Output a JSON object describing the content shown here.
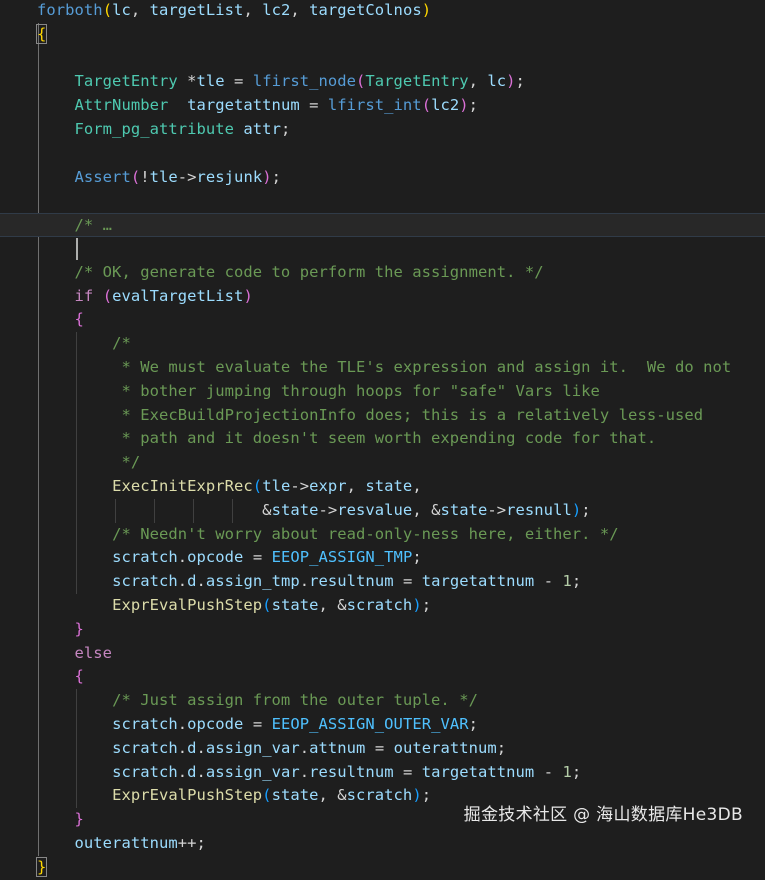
{
  "editor": {
    "language": "c",
    "cursor_line": 10,
    "highlighted_line": 9
  },
  "watermark": "掘金技术社区 @ 海山数据库He3DB",
  "lines": [
    [
      {
        "t": "forboth",
        "c": "k"
      },
      {
        "t": "(",
        "c": "b1"
      },
      {
        "t": "lc",
        "c": "v"
      },
      {
        "t": ", ",
        "c": "o"
      },
      {
        "t": "targetList",
        "c": "v"
      },
      {
        "t": ", ",
        "c": "o"
      },
      {
        "t": "lc2",
        "c": "v"
      },
      {
        "t": ", ",
        "c": "o"
      },
      {
        "t": "targetColnos",
        "c": "v"
      },
      {
        "t": ")",
        "c": "b1"
      }
    ],
    [
      {
        "t": "{",
        "c": "b1"
      }
    ],
    [],
    [
      {
        "t": "    ",
        "c": "o"
      },
      {
        "t": "TargetEntry",
        "c": "t"
      },
      {
        "t": " *",
        "c": "o"
      },
      {
        "t": "tle",
        "c": "v"
      },
      {
        "t": " = ",
        "c": "o"
      },
      {
        "t": "lfirst_node",
        "c": "k"
      },
      {
        "t": "(",
        "c": "b2"
      },
      {
        "t": "TargetEntry",
        "c": "t"
      },
      {
        "t": ", ",
        "c": "o"
      },
      {
        "t": "lc",
        "c": "v"
      },
      {
        "t": ")",
        "c": "b2"
      },
      {
        "t": ";",
        "c": "o"
      }
    ],
    [
      {
        "t": "    ",
        "c": "o"
      },
      {
        "t": "AttrNumber",
        "c": "t"
      },
      {
        "t": "  ",
        "c": "o"
      },
      {
        "t": "targetattnum",
        "c": "v"
      },
      {
        "t": " = ",
        "c": "o"
      },
      {
        "t": "lfirst_int",
        "c": "k"
      },
      {
        "t": "(",
        "c": "b2"
      },
      {
        "t": "lc2",
        "c": "v"
      },
      {
        "t": ")",
        "c": "b2"
      },
      {
        "t": ";",
        "c": "o"
      }
    ],
    [
      {
        "t": "    ",
        "c": "o"
      },
      {
        "t": "Form_pg_attribute",
        "c": "t"
      },
      {
        "t": " ",
        "c": "o"
      },
      {
        "t": "attr",
        "c": "v"
      },
      {
        "t": ";",
        "c": "o"
      }
    ],
    [],
    [
      {
        "t": "    ",
        "c": "o"
      },
      {
        "t": "Assert",
        "c": "k"
      },
      {
        "t": "(",
        "c": "b2"
      },
      {
        "t": "!",
        "c": "o"
      },
      {
        "t": "tle",
        "c": "v"
      },
      {
        "t": "->",
        "c": "o"
      },
      {
        "t": "resjunk",
        "c": "v"
      },
      {
        "t": ")",
        "c": "b2"
      },
      {
        "t": ";",
        "c": "o"
      }
    ],
    [],
    [
      {
        "t": "    ",
        "c": "o"
      },
      {
        "t": "/*",
        "c": "m"
      },
      {
        "t": " …",
        "c": "m"
      }
    ],
    [],
    [
      {
        "t": "    ",
        "c": "o"
      },
      {
        "t": "/* OK, generate code to perform the assignment. */",
        "c": "m"
      }
    ],
    [
      {
        "t": "    ",
        "c": "o"
      },
      {
        "t": "if",
        "c": "c"
      },
      {
        "t": " ",
        "c": "o"
      },
      {
        "t": "(",
        "c": "b2"
      },
      {
        "t": "evalTargetList",
        "c": "v"
      },
      {
        "t": ")",
        "c": "b2"
      }
    ],
    [
      {
        "t": "    ",
        "c": "o"
      },
      {
        "t": "{",
        "c": "b2"
      }
    ],
    [
      {
        "t": "        ",
        "c": "o"
      },
      {
        "t": "/*",
        "c": "m"
      }
    ],
    [
      {
        "t": "        ",
        "c": "o"
      },
      {
        "t": " * We must evaluate the TLE's expression and assign it.  We do not",
        "c": "m"
      }
    ],
    [
      {
        "t": "        ",
        "c": "o"
      },
      {
        "t": " * bother jumping through hoops for \"safe\" Vars like",
        "c": "m"
      }
    ],
    [
      {
        "t": "        ",
        "c": "o"
      },
      {
        "t": " * ExecBuildProjectionInfo does; this is a relatively less-used",
        "c": "m"
      }
    ],
    [
      {
        "t": "        ",
        "c": "o"
      },
      {
        "t": " * path and it doesn't seem worth expending code for that.",
        "c": "m"
      }
    ],
    [
      {
        "t": "        ",
        "c": "o"
      },
      {
        "t": " */",
        "c": "m"
      }
    ],
    [
      {
        "t": "        ",
        "c": "o"
      },
      {
        "t": "ExecInitExprRec",
        "c": "f"
      },
      {
        "t": "(",
        "c": "b3"
      },
      {
        "t": "tle",
        "c": "v"
      },
      {
        "t": "->",
        "c": "o"
      },
      {
        "t": "expr",
        "c": "v"
      },
      {
        "t": ", ",
        "c": "o"
      },
      {
        "t": "state",
        "c": "v"
      },
      {
        "t": ",",
        "c": "o"
      }
    ],
    [
      {
        "t": "                        ",
        "c": "o"
      },
      {
        "t": "&",
        "c": "o"
      },
      {
        "t": "state",
        "c": "v"
      },
      {
        "t": "->",
        "c": "o"
      },
      {
        "t": "resvalue",
        "c": "v"
      },
      {
        "t": ", &",
        "c": "o"
      },
      {
        "t": "state",
        "c": "v"
      },
      {
        "t": "->",
        "c": "o"
      },
      {
        "t": "resnull",
        "c": "v"
      },
      {
        "t": ")",
        "c": "b3"
      },
      {
        "t": ";",
        "c": "o"
      }
    ],
    [
      {
        "t": "        ",
        "c": "o"
      },
      {
        "t": "/* Needn't worry about read-only-ness here, either. */",
        "c": "m"
      }
    ],
    [
      {
        "t": "        ",
        "c": "o"
      },
      {
        "t": "scratch",
        "c": "v"
      },
      {
        "t": ".",
        "c": "o"
      },
      {
        "t": "opcode",
        "c": "v"
      },
      {
        "t": " = ",
        "c": "o"
      },
      {
        "t": "EEOP_ASSIGN_TMP",
        "c": "e"
      },
      {
        "t": ";",
        "c": "o"
      }
    ],
    [
      {
        "t": "        ",
        "c": "o"
      },
      {
        "t": "scratch",
        "c": "v"
      },
      {
        "t": ".",
        "c": "o"
      },
      {
        "t": "d",
        "c": "v"
      },
      {
        "t": ".",
        "c": "o"
      },
      {
        "t": "assign_tmp",
        "c": "v"
      },
      {
        "t": ".",
        "c": "o"
      },
      {
        "t": "resultnum",
        "c": "v"
      },
      {
        "t": " = ",
        "c": "o"
      },
      {
        "t": "targetattnum",
        "c": "v"
      },
      {
        "t": " - ",
        "c": "o"
      },
      {
        "t": "1",
        "c": "n"
      },
      {
        "t": ";",
        "c": "o"
      }
    ],
    [
      {
        "t": "        ",
        "c": "o"
      },
      {
        "t": "ExprEvalPushStep",
        "c": "f"
      },
      {
        "t": "(",
        "c": "b3"
      },
      {
        "t": "state",
        "c": "v"
      },
      {
        "t": ", &",
        "c": "o"
      },
      {
        "t": "scratch",
        "c": "v"
      },
      {
        "t": ")",
        "c": "b3"
      },
      {
        "t": ";",
        "c": "o"
      }
    ],
    [
      {
        "t": "    ",
        "c": "o"
      },
      {
        "t": "}",
        "c": "b2"
      }
    ],
    [
      {
        "t": "    ",
        "c": "o"
      },
      {
        "t": "else",
        "c": "c"
      }
    ],
    [
      {
        "t": "    ",
        "c": "o"
      },
      {
        "t": "{",
        "c": "b2"
      }
    ],
    [
      {
        "t": "        ",
        "c": "o"
      },
      {
        "t": "/* Just assign from the outer tuple. */",
        "c": "m"
      }
    ],
    [
      {
        "t": "        ",
        "c": "o"
      },
      {
        "t": "scratch",
        "c": "v"
      },
      {
        "t": ".",
        "c": "o"
      },
      {
        "t": "opcode",
        "c": "v"
      },
      {
        "t": " = ",
        "c": "o"
      },
      {
        "t": "EEOP_ASSIGN_OUTER_VAR",
        "c": "e"
      },
      {
        "t": ";",
        "c": "o"
      }
    ],
    [
      {
        "t": "        ",
        "c": "o"
      },
      {
        "t": "scratch",
        "c": "v"
      },
      {
        "t": ".",
        "c": "o"
      },
      {
        "t": "d",
        "c": "v"
      },
      {
        "t": ".",
        "c": "o"
      },
      {
        "t": "assign_var",
        "c": "v"
      },
      {
        "t": ".",
        "c": "o"
      },
      {
        "t": "attnum",
        "c": "v"
      },
      {
        "t": " = ",
        "c": "o"
      },
      {
        "t": "outerattnum",
        "c": "v"
      },
      {
        "t": ";",
        "c": "o"
      }
    ],
    [
      {
        "t": "        ",
        "c": "o"
      },
      {
        "t": "scratch",
        "c": "v"
      },
      {
        "t": ".",
        "c": "o"
      },
      {
        "t": "d",
        "c": "v"
      },
      {
        "t": ".",
        "c": "o"
      },
      {
        "t": "assign_var",
        "c": "v"
      },
      {
        "t": ".",
        "c": "o"
      },
      {
        "t": "resultnum",
        "c": "v"
      },
      {
        "t": " = ",
        "c": "o"
      },
      {
        "t": "targetattnum",
        "c": "v"
      },
      {
        "t": " - ",
        "c": "o"
      },
      {
        "t": "1",
        "c": "n"
      },
      {
        "t": ";",
        "c": "o"
      }
    ],
    [
      {
        "t": "        ",
        "c": "o"
      },
      {
        "t": "ExprEvalPushStep",
        "c": "f"
      },
      {
        "t": "(",
        "c": "b3"
      },
      {
        "t": "state",
        "c": "v"
      },
      {
        "t": ", &",
        "c": "o"
      },
      {
        "t": "scratch",
        "c": "v"
      },
      {
        "t": ")",
        "c": "b3"
      },
      {
        "t": ";",
        "c": "o"
      }
    ],
    [
      {
        "t": "    ",
        "c": "o"
      },
      {
        "t": "}",
        "c": "b2"
      }
    ],
    [
      {
        "t": "    ",
        "c": "o"
      },
      {
        "t": "outerattnum",
        "c": "v"
      },
      {
        "t": "++;",
        "c": "o"
      }
    ],
    [
      {
        "t": "}",
        "c": "b1"
      }
    ]
  ]
}
